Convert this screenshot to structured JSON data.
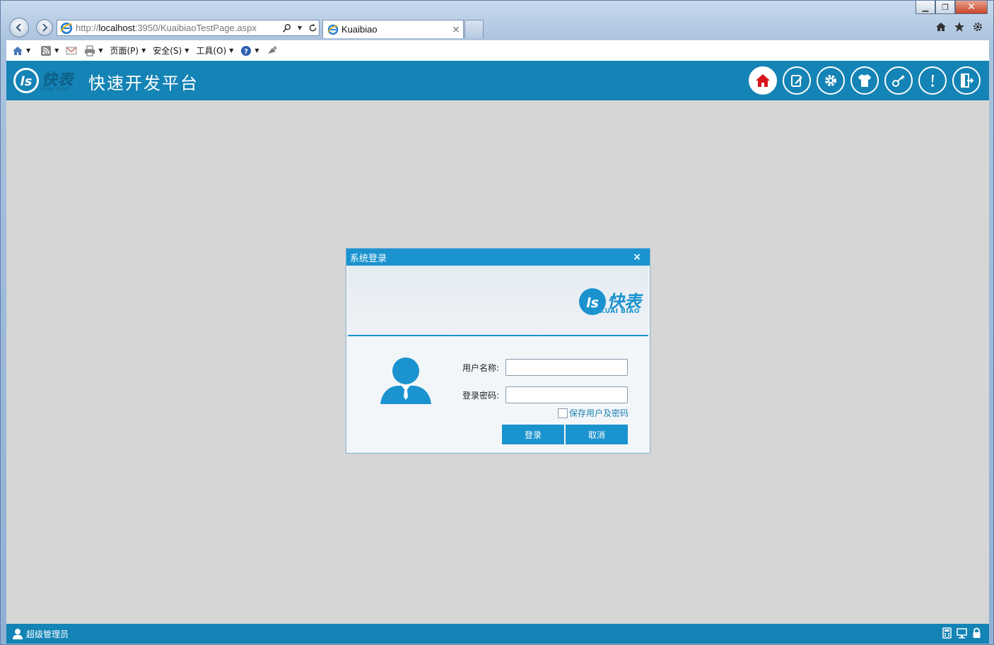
{
  "browser": {
    "address": {
      "prefix": "http://",
      "host": "localhost",
      "path": ":3950/KuaibiaoTestPage.aspx"
    },
    "tab_title": "Kuaibiao",
    "tab_close": "×",
    "commands": [
      {
        "label": "页面(P)"
      },
      {
        "label": "安全(S)"
      },
      {
        "label": "工具(O)"
      }
    ]
  },
  "app": {
    "title": "快速开发平台",
    "logo_word": "快表",
    "logo_sub": "KUAI BIAO",
    "header_icons": [
      "home-icon",
      "edit-icon",
      "gear-icon",
      "shirt-icon",
      "key-icon",
      "alert-icon",
      "logout-icon"
    ],
    "accent_color": "#1483b5"
  },
  "dialog": {
    "title": "系统登录",
    "close": "×",
    "logo_word": "快表",
    "logo_sub": "KUAI BIAO",
    "username_label": "用户名称:",
    "username_value": "",
    "password_label": "登录密码:",
    "password_value": "",
    "remember_label": "保存用户及密码",
    "remember_checked": false,
    "login_button": "登录",
    "cancel_button": "取消"
  },
  "footer": {
    "user": "超级管理员",
    "icons": [
      "calculator-icon",
      "monitor-icon",
      "lock-icon"
    ]
  }
}
